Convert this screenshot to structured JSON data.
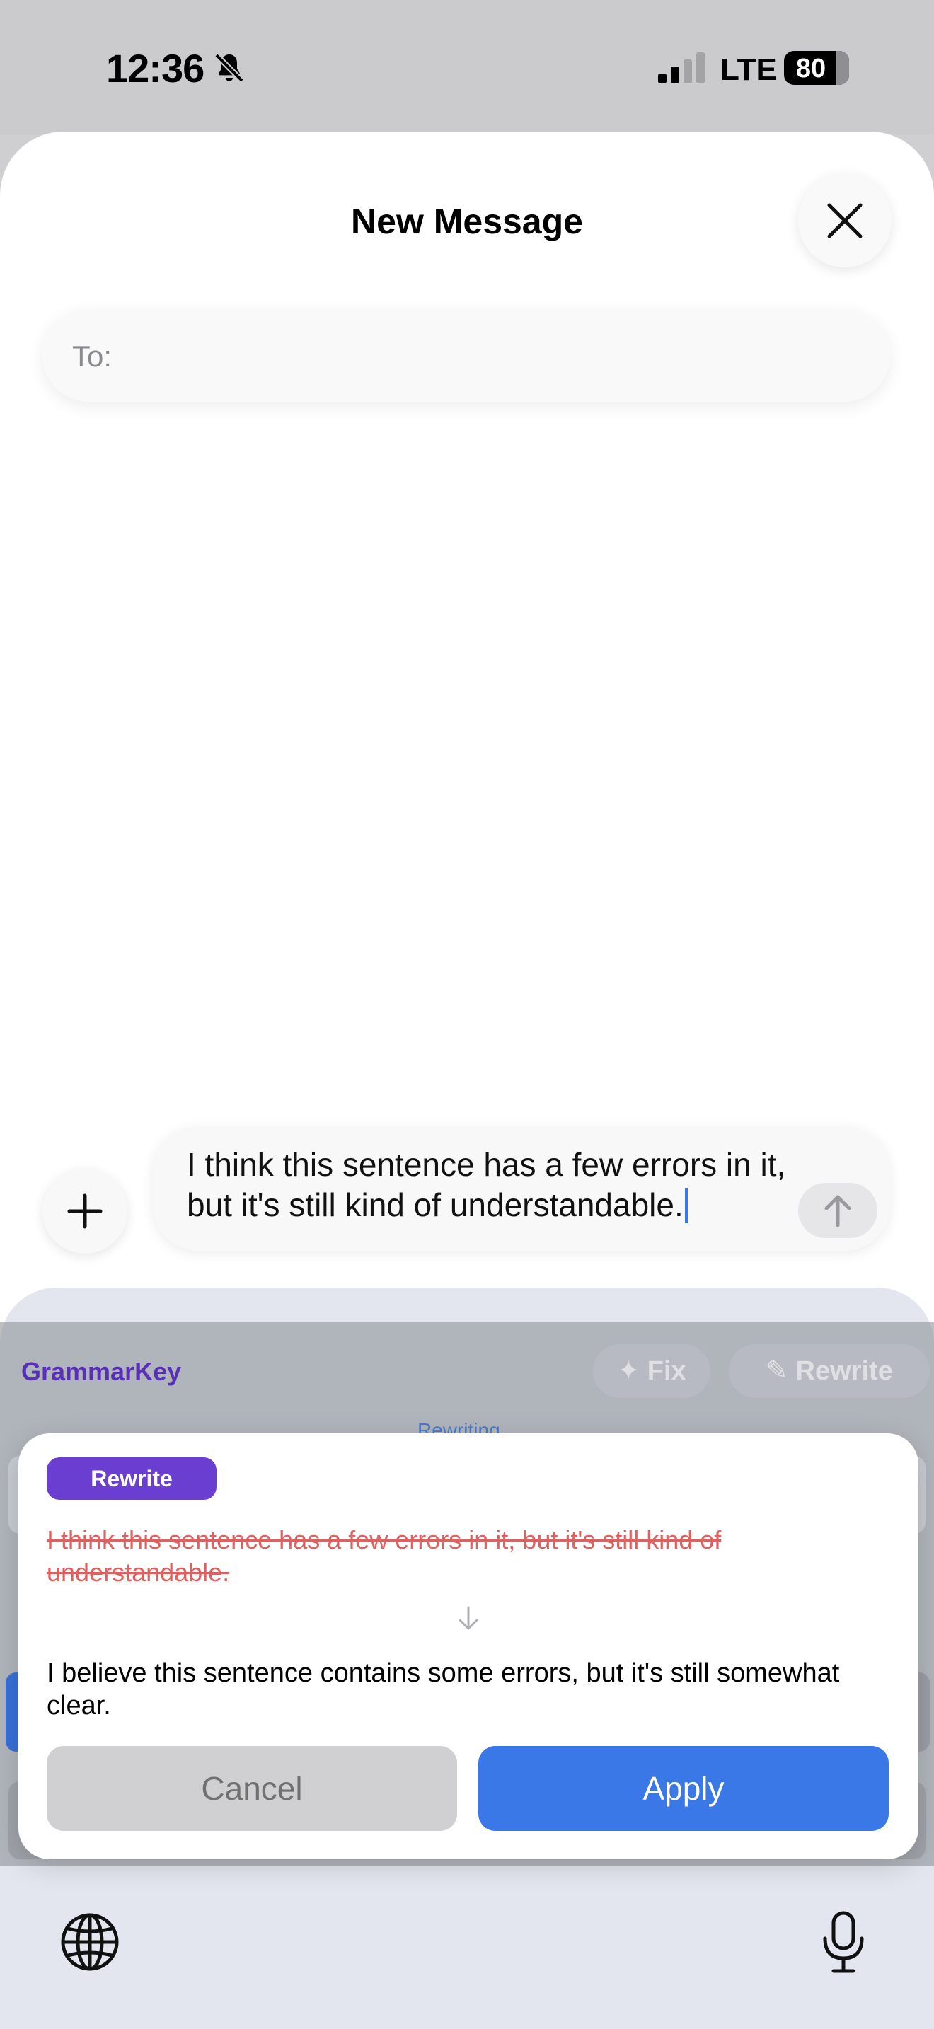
{
  "status_bar": {
    "time": "12:36",
    "network": "LTE",
    "battery": "80"
  },
  "header": {
    "title": "New Message"
  },
  "recipient": {
    "label": "To:"
  },
  "compose": {
    "text": "I think this sentence has a few errors in it, but it's still kind of understandable."
  },
  "keyboard": {
    "brand": "GrammarKey",
    "fix_label": "✦ Fix",
    "rewrite_label": "✎ Rewrite",
    "status_text": "Rewriting..."
  },
  "rewrite_card": {
    "badge": "Rewrite",
    "original": "I think this sentence has a few errors in it, but it's still kind of understandable.",
    "rewritten": "I believe this sentence contains some errors, but it's still somewhat clear.",
    "cancel_label": "Cancel",
    "apply_label": "Apply"
  },
  "colors": {
    "brand": "#5a2fb8",
    "badge": "#6a3ed0",
    "apply": "#3b78e7",
    "deleted_text": "#e06060"
  }
}
